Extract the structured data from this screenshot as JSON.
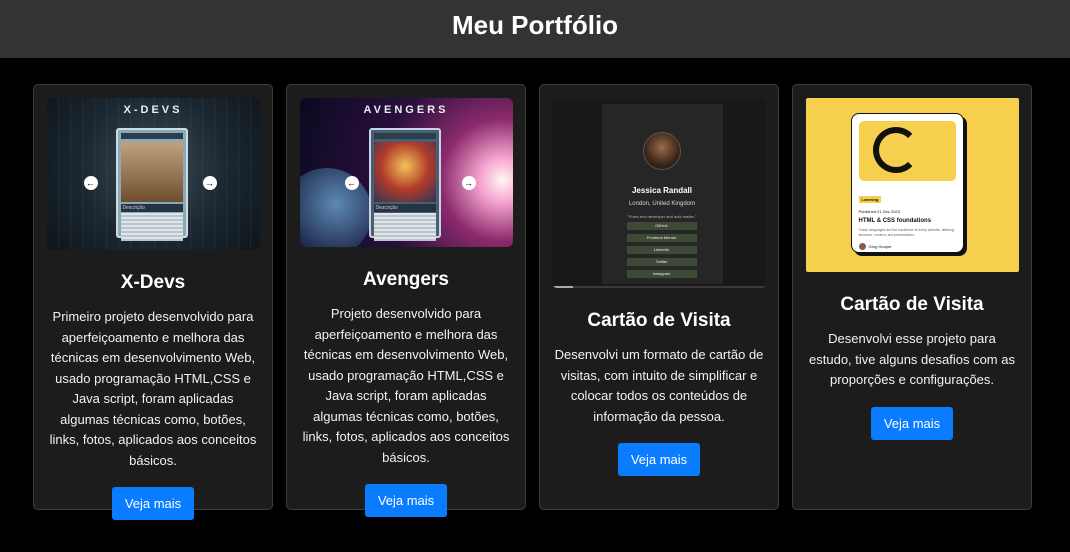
{
  "header": {
    "title": "Meu Portfólio"
  },
  "projects": [
    {
      "thumb_title": "X-DEVS",
      "mini_card_label": "Descrição",
      "title": "X-Devs",
      "description": "Primeiro projeto desenvolvido para aperfeiçoamento e melhora das técnicas em desenvolvimento Web, usado programação HTML,CSS e Java script, foram aplicadas algumas técnicas como, botões, links, fotos, aplicados aos conceitos básicos.",
      "button": "Veja mais"
    },
    {
      "thumb_title": "AVENGERS",
      "mini_card_label": "Descrição",
      "title": "Avengers",
      "description": "Projeto desenvolvido para aperfeiçoamento e melhora das técnicas em desenvolvimento Web, usado programação HTML,CSS e Java script, foram aplicadas algumas técnicas como, botões, links, fotos, aplicados aos conceitos básicos.",
      "button": "Veja mais"
    },
    {
      "thumb_name": "Jessica Randall",
      "thumb_location": "London, United Kingdom",
      "thumb_quote": "\"Front-end developer and avid reader.\"",
      "thumb_links": [
        "GitHub",
        "Frontend Mentor",
        "LinkedIn",
        "Twitter",
        "Instagram"
      ],
      "title": "Cartão de Visita",
      "description": "Desenvolvi um formato de cartão de visitas, com intuito de simplificar e colocar todos os conteúdos de informação da pessoa.",
      "button": "Veja mais"
    },
    {
      "thumb_tag": "Learning",
      "thumb_published": "Published 21 Dec 2023",
      "thumb_title": "HTML & CSS foundations",
      "thumb_text": "These languages are the backbone of every website, defining structure, content, and presentation.",
      "thumb_author": "Greg Hooper",
      "title": "Cartão de Visita",
      "description": "Desenvolvi esse projeto para estudo, tive alguns desafios com as proporções e configurações.",
      "button": "Veja mais"
    }
  ]
}
